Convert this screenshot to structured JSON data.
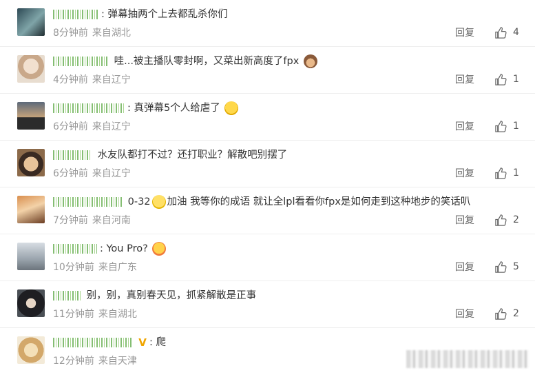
{
  "comments": [
    {
      "text": "弹幕抽两个上去都乱杀你们",
      "emoji": "",
      "time": "8分钟前",
      "location": "来自湖北",
      "reply": "回复",
      "likes": "4"
    },
    {
      "text": "哇...被主播队零封啊，又菜出新高度了fpx",
      "emoji": "monkey-face",
      "time": "4分钟前",
      "location": "来自辽宁",
      "reply": "回复",
      "likes": "1"
    },
    {
      "text": "真弹幕5个人给虐了",
      "emoji": "laughing-face",
      "time": "6分钟前",
      "location": "来自辽宁",
      "reply": "回复",
      "likes": "1"
    },
    {
      "text": "水友队都打不过？还打职业？解散吧别摆了",
      "emoji": "",
      "time": "6分钟前",
      "location": "来自辽宁",
      "reply": "回复",
      "likes": "1"
    },
    {
      "text": "0-32",
      "text2": "加油 我等你的成语 就让全lpl看看你fpx是如何走到这种地步的笑话叭",
      "emoji": "smile-face",
      "time": "7分钟前",
      "location": "来自河南",
      "reply": "回复",
      "likes": "2"
    },
    {
      "text": "You Pro?",
      "emoji": "surprised-face",
      "time": "10分钟前",
      "location": "来自广东",
      "reply": "回复",
      "likes": "5"
    },
    {
      "text": "别，别，真别春天见，抓紧解散是正事",
      "emoji": "",
      "time": "11分钟前",
      "location": "来自湖北",
      "reply": "回复",
      "likes": "2"
    },
    {
      "text": "爬",
      "emoji": "",
      "verified": "V",
      "time": "12分钟前",
      "location": "来自天津",
      "reply": "",
      "likes": ""
    }
  ],
  "colors": {
    "meta": "#999999",
    "nickname": "#6fb35a",
    "verified": "#f0a500",
    "border": "#eeeeee"
  }
}
